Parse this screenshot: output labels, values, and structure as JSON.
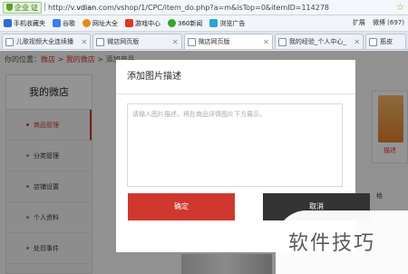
{
  "browser": {
    "security_label": "企业",
    "security_sub": "证",
    "url_prefix": "http://v.",
    "url_domain": "vdian",
    "url_rest": ".com/vshop/1/CPC/item_do.php?a=m&isTop=0&itemID=114278"
  },
  "bookmarks": {
    "items": [
      {
        "label": "手机收藏夹",
        "color": "#2d6fc9"
      },
      {
        "label": "谷歌",
        "color": "#3a7ee8"
      },
      {
        "label": "网址大全",
        "color": "#e58b1a"
      },
      {
        "label": "游戏中心",
        "color": "#e0381f"
      },
      {
        "label": "360新闻",
        "color": "#36a52a"
      },
      {
        "label": "浏览广告",
        "color": "#2aa3d8"
      }
    ],
    "right_items": [
      "扩展",
      "微博 (697)"
    ]
  },
  "tabs": [
    {
      "label": "儿歌视频大全连续播",
      "active": false
    },
    {
      "label": "微店网页版",
      "active": false
    },
    {
      "label": "微店网页版",
      "active": true
    },
    {
      "label": "我的经验_个人中心_",
      "active": false
    },
    {
      "label": "筋皮",
      "active": false
    }
  ],
  "page": {
    "breadcrumb": {
      "prefix": "你的位置：",
      "home": "微店",
      "sep": " > ",
      "shop": "我的微店",
      "tail": " > 添加商品"
    },
    "sidebar": {
      "title": "我的微店",
      "items": [
        {
          "label": "商品管理",
          "active": true
        },
        {
          "label": "分类管理",
          "active": false
        },
        {
          "label": "店铺设置",
          "active": false
        },
        {
          "label": "个人资料",
          "active": false
        },
        {
          "label": "处罚事件",
          "active": false
        }
      ]
    },
    "right_link": "描述",
    "right_tail": "格"
  },
  "modal": {
    "title": "添加图片描述",
    "placeholder": "请输入图片描述，将在商品详情图片下方展示。",
    "confirm": "确定",
    "cancel": "取消"
  },
  "watermark": "软件技巧"
}
